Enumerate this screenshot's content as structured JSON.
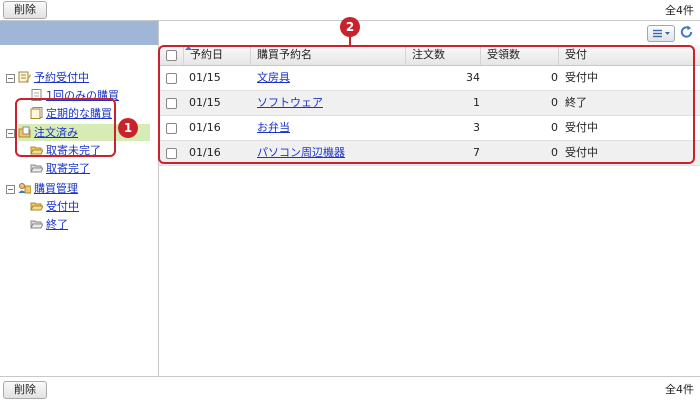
{
  "toolbar_top": {
    "delete_label": "削除",
    "count": "全4件"
  },
  "toolbar_bottom": {
    "delete_label": "削除",
    "count": "全4件"
  },
  "tree": {
    "root1": {
      "label": "予約受付中",
      "children": [
        "1回のみの購買",
        "定期的な購買"
      ]
    },
    "root2": {
      "label": "注文済み",
      "children": [
        "取寄未完了",
        "取寄完了"
      ]
    },
    "root3": {
      "label": "購買管理",
      "children": [
        "受付中",
        "終了"
      ]
    }
  },
  "table": {
    "columns": [
      "予約日",
      "購買予約名",
      "注文数",
      "受領数",
      "受付"
    ],
    "rows": [
      {
        "date": "01/15",
        "name": "文房具",
        "ordered": "34",
        "received": "0",
        "status": "受付中"
      },
      {
        "date": "01/15",
        "name": "ソフトウェア",
        "ordered": "1",
        "received": "0",
        "status": "終了"
      },
      {
        "date": "01/16",
        "name": "お弁当",
        "ordered": "3",
        "received": "0",
        "status": "受付中"
      },
      {
        "date": "01/16",
        "name": "パソコン周辺機器",
        "ordered": "7",
        "received": "0",
        "status": "受付中"
      }
    ]
  },
  "annotations": {
    "badge1": "1",
    "badge2": "2"
  }
}
